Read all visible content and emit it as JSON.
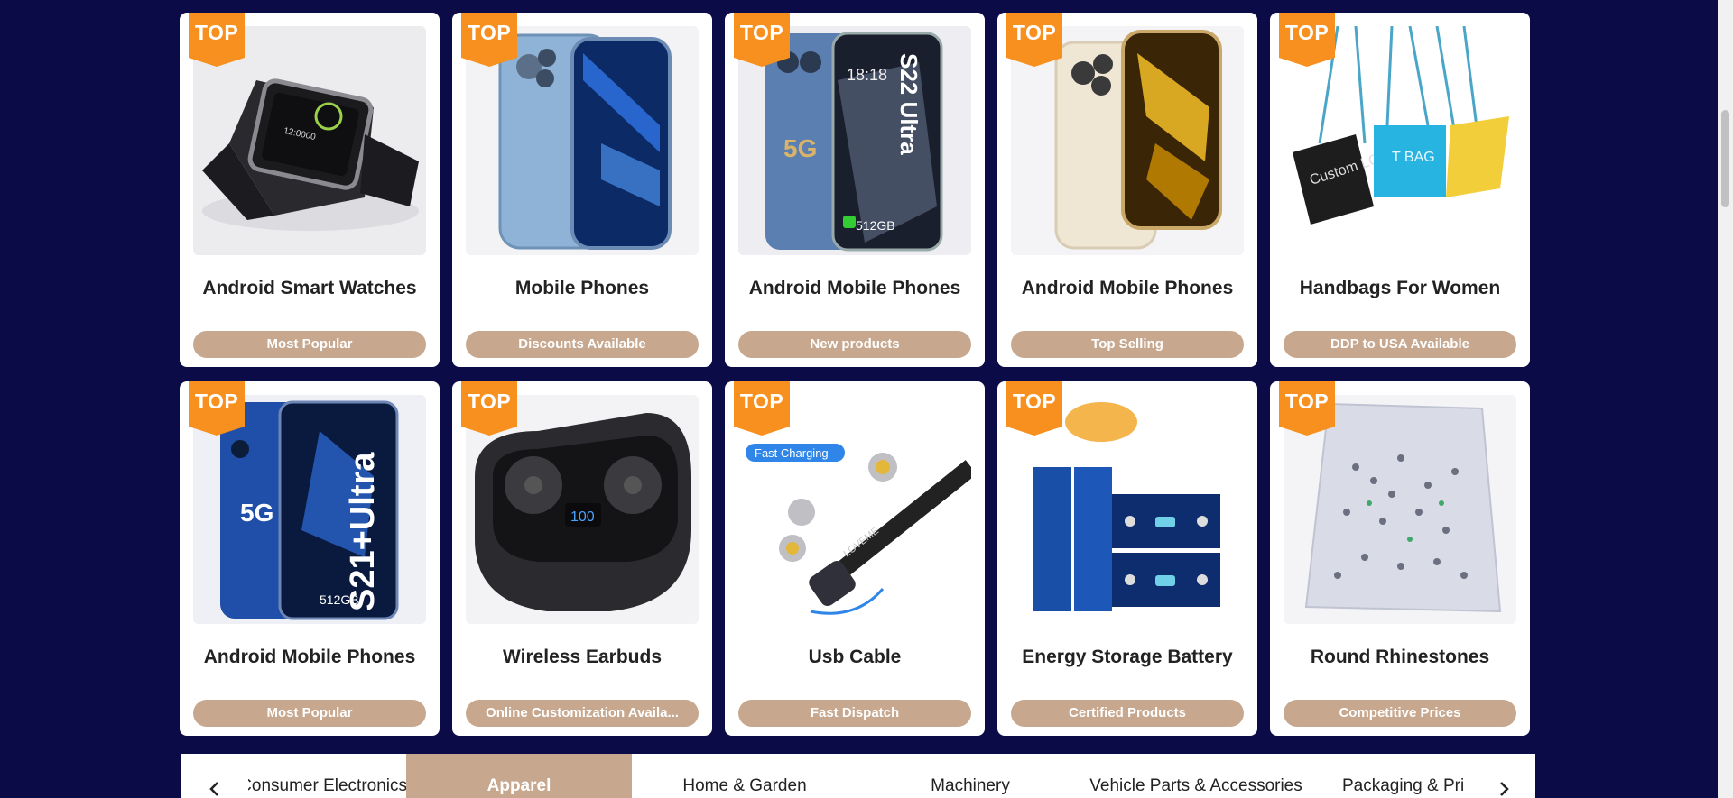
{
  "colors": {
    "background": "#0b0b47",
    "accent": "#c7a78d",
    "badge": "#f7901e"
  },
  "badge_label": "TOP",
  "products": [
    {
      "title": "Android Smart Watches",
      "tag": "Most Popular",
      "image": "smart-watch-image"
    },
    {
      "title": "Mobile Phones",
      "tag": "Discounts Available",
      "image": "blue-phone-image"
    },
    {
      "title": "Android Mobile Phones",
      "tag": "New products",
      "image": "s22-ultra-phone-image"
    },
    {
      "title": "Android Mobile Phones",
      "tag": "Top Selling",
      "image": "gold-phone-image"
    },
    {
      "title": "Handbags For Women",
      "tag": "DDP to USA Available",
      "image": "handbags-image"
    },
    {
      "title": "Android Mobile Phones",
      "tag": "Most Popular",
      "image": "s21-ultra-phone-image"
    },
    {
      "title": "Wireless Earbuds",
      "tag": "Online Customization Availa...",
      "image": "earbuds-image"
    },
    {
      "title": "Usb Cable",
      "tag": "Fast Dispatch",
      "image": "usb-cable-image"
    },
    {
      "title": "Energy Storage Battery",
      "tag": "Certified Products",
      "image": "battery-image"
    },
    {
      "title": "Round Rhinestones",
      "tag": "Competitive Prices",
      "image": "rhinestones-image"
    }
  ],
  "category_tabs": [
    {
      "label": "Consumer Electronics",
      "active": false
    },
    {
      "label": "Apparel",
      "active": true
    },
    {
      "label": "Home & Garden",
      "active": false
    },
    {
      "label": "Machinery",
      "active": false
    },
    {
      "label": "Vehicle Parts & Accessories",
      "active": false
    },
    {
      "label": "Packaging & Printing",
      "active": false
    }
  ],
  "image_text": {
    "s22_clock": "18:18",
    "s22_name": "S22 Ultra",
    "s22_storage": "512GB",
    "s22_network": "5G",
    "s21_network": "5G",
    "s21_name": "S21+Ultra",
    "s21_storage": "512GB",
    "earbuds_display": "100",
    "cable_tag": "Fast Charging",
    "cable_brand": "LOVEME",
    "handbag_text_1": "Custom LOGO",
    "handbag_text_2": "T BAG",
    "watch_time": "12:0000"
  }
}
